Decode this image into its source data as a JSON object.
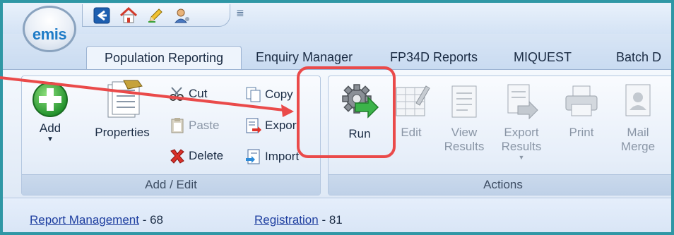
{
  "app": {
    "logo_text": "emis"
  },
  "quick_access": {
    "icons": [
      "back-arrow-icon",
      "home-icon",
      "pencil-icon",
      "user-icon"
    ],
    "overflow_glyph": "≣"
  },
  "tabs": [
    {
      "label": "Population Reporting",
      "active": true
    },
    {
      "label": "Enquiry Manager",
      "active": false
    },
    {
      "label": "FP34D Reports",
      "active": false
    },
    {
      "label": "MIQUEST",
      "active": false
    },
    {
      "label": "Batch D",
      "active": false
    }
  ],
  "ribbon": {
    "add_edit": {
      "label": "Add / Edit",
      "add": "Add",
      "properties": "Properties",
      "cut": "Cut",
      "copy": "Copy",
      "paste": "Paste",
      "export": "Export",
      "delete": "Delete",
      "import": "Import"
    },
    "actions": {
      "label": "Actions",
      "run": "Run",
      "edit": "Edit",
      "view_results_1": "View",
      "view_results_2": "Results",
      "export_results_1": "Export",
      "export_results_2": "Results",
      "print": "Print",
      "mail_merge_1": "Mail",
      "mail_merge_2": "Merge"
    }
  },
  "status": {
    "report_management_label": "Report Management",
    "report_management_count": "- 68",
    "registration_label": "Registration",
    "registration_count": "- 81"
  },
  "colors": {
    "frame": "#2f97a5",
    "highlight": "#ea4a4a",
    "link": "#1f3fa0"
  }
}
